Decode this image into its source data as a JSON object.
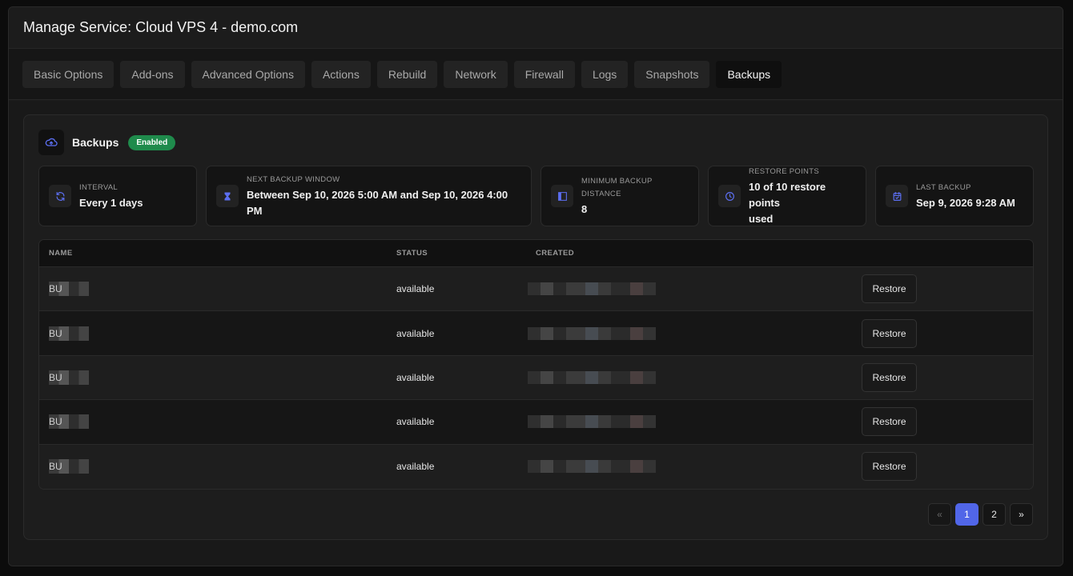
{
  "window": {
    "title": "Manage Service: Cloud VPS 4 - demo.com"
  },
  "tabs": [
    {
      "label": "Basic Options"
    },
    {
      "label": "Add-ons"
    },
    {
      "label": "Advanced Options"
    },
    {
      "label": "Actions"
    },
    {
      "label": "Rebuild"
    },
    {
      "label": "Network"
    },
    {
      "label": "Firewall"
    },
    {
      "label": "Logs"
    },
    {
      "label": "Snapshots"
    },
    {
      "label": "Backups",
      "active": true
    }
  ],
  "panel": {
    "title": "Backups",
    "badge": "Enabled",
    "icon": "cloud-upload-icon"
  },
  "stats": [
    {
      "label": "INTERVAL",
      "value": "Every 1 days",
      "icon": "refresh-icon"
    },
    {
      "label": "NEXT BACKUP WINDOW",
      "value": "Between Sep 10, 2026 5:00 AM and Sep 10, 2026 4:00 PM",
      "icon": "hourglass-icon"
    },
    {
      "label_line1": "MINIMUM BACKUP",
      "label_line2": "DISTANCE",
      "value": "8",
      "icon": "ruler-icon"
    },
    {
      "label": "RESTORE POINTS",
      "value_line1": "10 of 10 restore points",
      "value_line2": "used",
      "icon": "clock-icon"
    },
    {
      "label": "LAST BACKUP",
      "value": "Sep 9, 2026 9:28 AM",
      "icon": "calendar-icon"
    }
  ],
  "table": {
    "headers": {
      "name": "NAME",
      "status": "STATUS",
      "created": "CREATED"
    },
    "rows": [
      {
        "name_prefix": "BU",
        "status": "available",
        "action": "Restore"
      },
      {
        "name_prefix": "BU",
        "status": "available",
        "action": "Restore"
      },
      {
        "name_prefix": "BU",
        "status": "available",
        "action": "Restore"
      },
      {
        "name_prefix": "BU",
        "status": "available",
        "action": "Restore"
      },
      {
        "name_prefix": "BU",
        "status": "available",
        "action": "Restore"
      }
    ]
  },
  "pagination": {
    "prev": "«",
    "pages": [
      "1",
      "2"
    ],
    "current": "1",
    "next": "»"
  },
  "colors": {
    "accent": "#5166e8",
    "badge": "#1f8b4c",
    "icon": "#5b6ef0"
  }
}
